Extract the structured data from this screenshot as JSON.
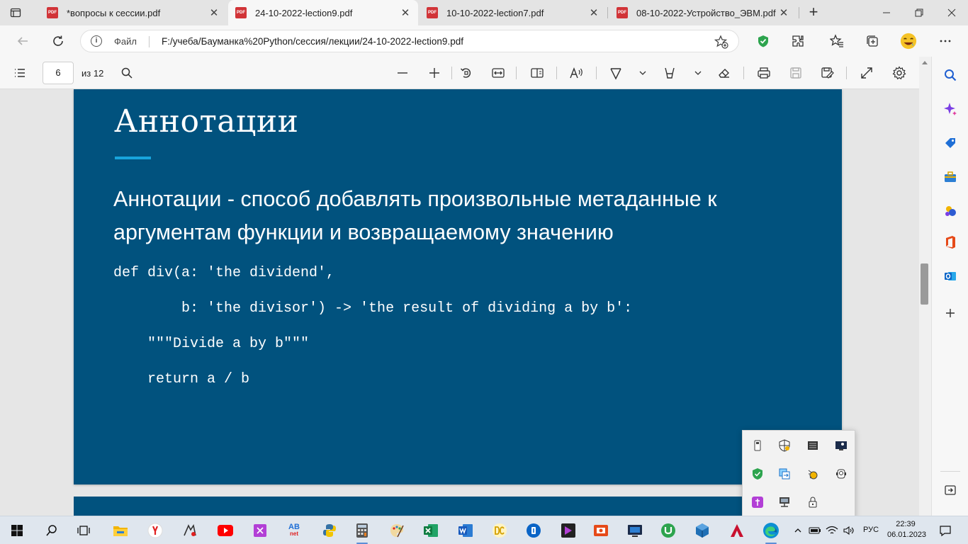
{
  "tabs": [
    {
      "title": "*вопросы к сессии.pdf",
      "active": false
    },
    {
      "title": "24-10-2022-lection9.pdf",
      "active": true
    },
    {
      "title": "10-10-2022-lection7.pdf",
      "active": false
    },
    {
      "title": "08-10-2022-Устройство_ЭВМ.pdf",
      "active": false
    }
  ],
  "pdf_badge": "PDF",
  "address": {
    "label": "Файл",
    "url": "F:/учеба/Бауманка%20Python/сессия/лекции/24-10-2022-lection9.pdf"
  },
  "pdf_toolbar": {
    "page_current": "6",
    "page_total": "из 12"
  },
  "slide": {
    "title": "Аннотации",
    "text": "Аннотации - способ добавлять произвольные метаданные к аргументам функции и возвращаемому значению",
    "code": [
      "def div(a: 'the dividend',",
      "        b: 'the divisor') -> 'the result of dividing a by b':",
      "    \"\"\"Divide a by b\"\"\"",
      "    return a / b"
    ]
  },
  "taskbar": {
    "lang": "РУС",
    "time": "22:39",
    "date": "06.01.2023",
    "app_labels": {
      "abc": "AB",
      "net": "net"
    }
  },
  "colors": {
    "slide_bg": "#01527e",
    "slide_accent": "#18a4dc",
    "pdf_tab_icon": "#d13438"
  }
}
